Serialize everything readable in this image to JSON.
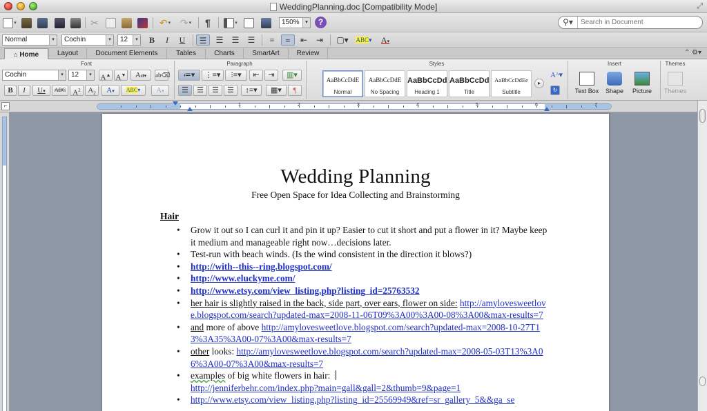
{
  "window": {
    "title": "WeddingPlanning.doc [Compatibility Mode]"
  },
  "toolbar": {
    "zoom": "150%",
    "search_placeholder": "Search in Document"
  },
  "format_bar": {
    "style": "Normal",
    "font": "Cochin",
    "size": "12"
  },
  "tabs": [
    {
      "label": "Home"
    },
    {
      "label": "Layout"
    },
    {
      "label": "Document Elements"
    },
    {
      "label": "Tables"
    },
    {
      "label": "Charts"
    },
    {
      "label": "SmartArt"
    },
    {
      "label": "Review"
    }
  ],
  "ribbon": {
    "groups": {
      "font": "Font",
      "paragraph": "Paragraph",
      "styles": "Styles",
      "insert": "Insert",
      "themes": "Themes"
    },
    "font_name": "Cochin",
    "font_size": "12",
    "styles": [
      {
        "sample": "AaBbCcDdE",
        "name": "Normal"
      },
      {
        "sample": "AaBbCcDdE",
        "name": "No Spacing"
      },
      {
        "sample": "AaBbCcDd",
        "name": "Heading 1"
      },
      {
        "sample": "AaBbCcDd",
        "name": "Title"
      },
      {
        "sample": "AaBbCcDdEe",
        "name": "Subtitle"
      }
    ],
    "insert": [
      {
        "label": "Text Box"
      },
      {
        "label": "Shape"
      },
      {
        "label": "Picture"
      }
    ],
    "themes_label": "Themes"
  },
  "ruler_numbers": [
    "1",
    "2",
    "3",
    "4",
    "5",
    "6",
    "7"
  ],
  "document": {
    "title": "Wedding Planning",
    "subtitle": "Free Open Space for Idea Collecting and Brainstorming",
    "section": "Hair",
    "items": {
      "i1": "Grow it out so I can curl it and pin it up?  Easier to cut it short and put a flower in it?  Maybe keep it medium and manageable right now…decisions later.",
      "i2": "Test-run with beach winds.  (Is the wind consistent in the direction it blows?)",
      "l1": "http://with--this--ring.blogspot.com/",
      "l2": "http://www.eluckyme.com/",
      "l3": "http://www.etsy.com/view_listing.php?listing_id=25763532",
      "i6_text": "her hair is slightly raised in the back, side part, over ears, flower on side:",
      "i6_link": "http://amylovesweetlove.blogspot.com/search?updated-max=2008-11-06T09%3A00%3A00-08%3A00&max-results=7",
      "i7_text": "and",
      "i7_mid": " more of above ",
      "i7_link": "http://amylovesweetlove.blogspot.com/search?updated-max=2008-10-27T13%3A35%3A00-07%3A00&max-results=7",
      "i8_text": "other",
      "i8_mid": " looks: ",
      "i8_link": "http://amylovesweetlove.blogspot.com/search?updated-max=2008-05-03T13%3A06%3A00-07%3A00&max-results=7",
      "i9_text": "examples",
      "i9_mid": " of big white flowers in hair:",
      "i9_link": "http://jenniferbehr.com/index.php?main=gall&gall=2&thumb=9&page=1",
      "l10": "http://www.etsy.com/view_listing.php?listing_id=25569949&ref=sr_gallery_5&&ga_se"
    }
  },
  "colors": {
    "link": "#1f2fc6",
    "selected_style": "#6f8fc2",
    "help": "#7a4fb5"
  }
}
